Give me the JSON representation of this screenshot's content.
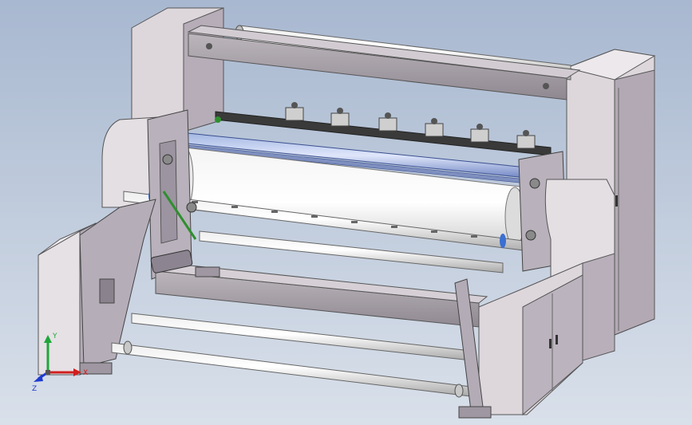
{
  "viewport": {
    "background_top": "#a8b8d0",
    "background_bottom": "#d9e0ea"
  },
  "model": {
    "body_color": "#c9c4c8",
    "body_dark": "#8d8690",
    "roller_color": "#d7d7d7",
    "accent_blue": "#3b6fd1",
    "accent_green": "#2f8f2f"
  },
  "triad": {
    "x_label": "X",
    "y_label": "Y",
    "z_label": "Z",
    "x_color": "#d11f1f",
    "y_color": "#1fa63a",
    "z_color": "#1f3bd1"
  }
}
